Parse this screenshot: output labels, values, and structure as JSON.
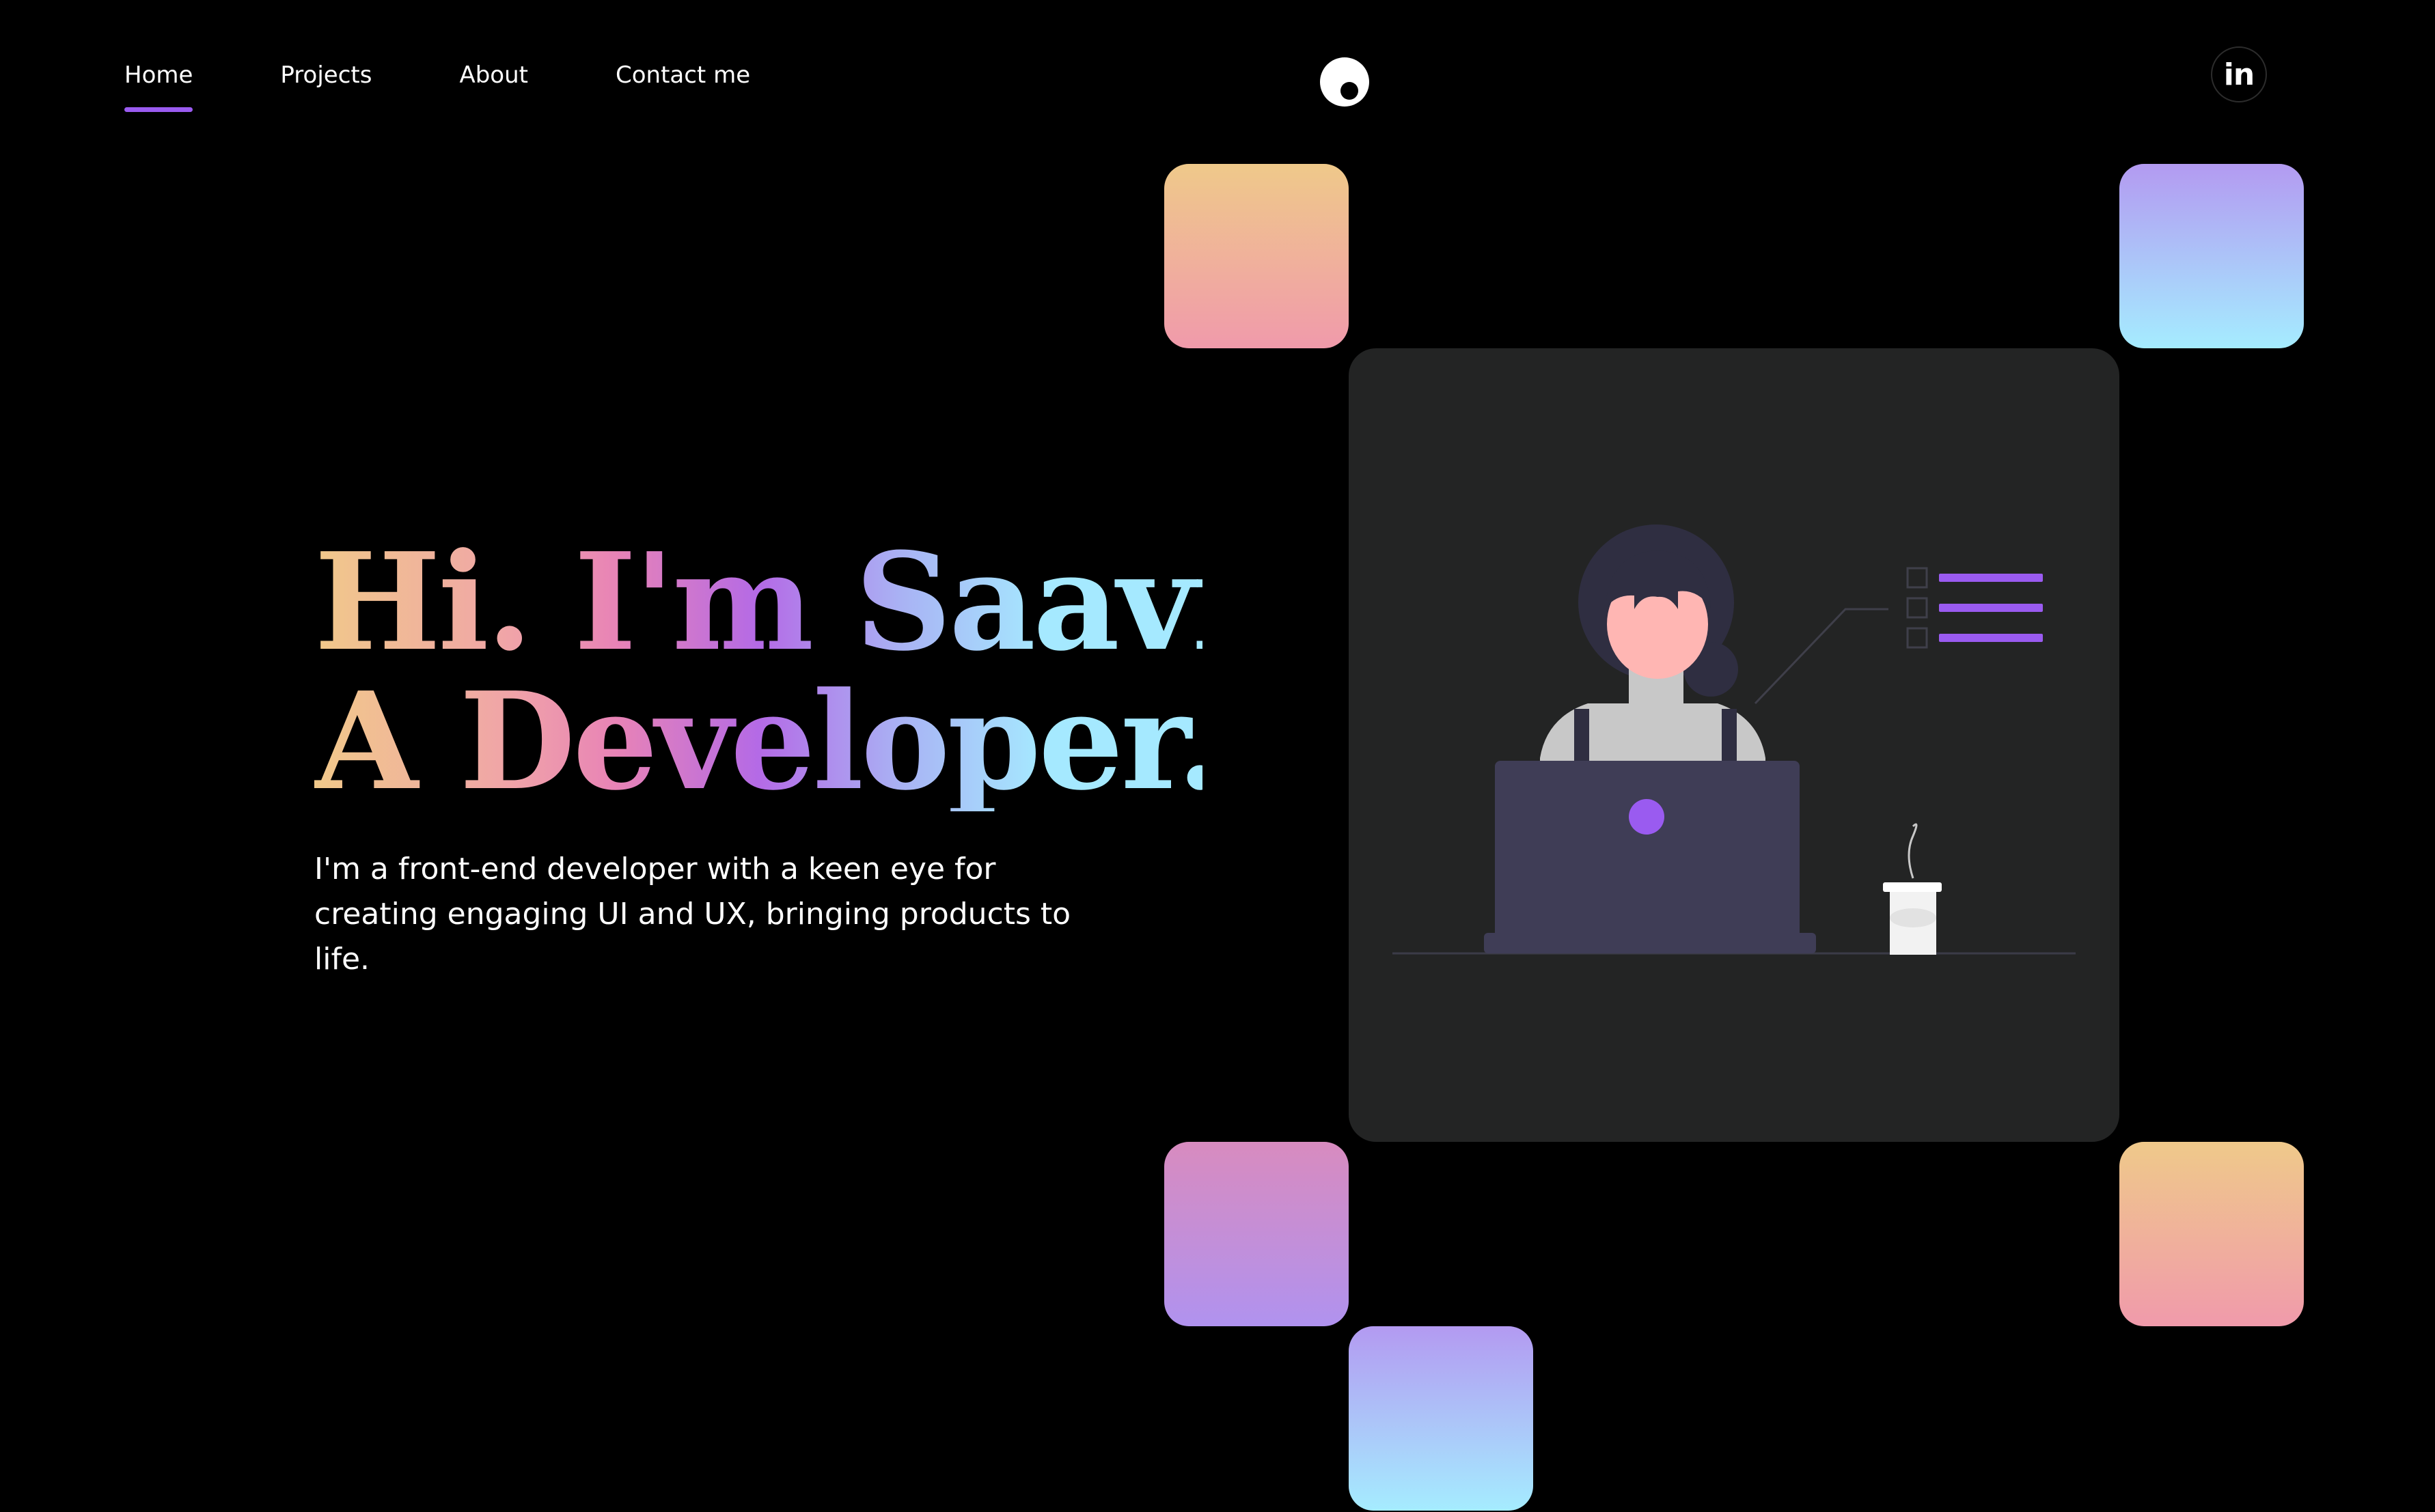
{
  "nav": {
    "items": [
      {
        "label": "Home",
        "active": true
      },
      {
        "label": "Projects",
        "active": false
      },
      {
        "label": "About",
        "active": false
      },
      {
        "label": "Contact me",
        "active": false
      }
    ]
  },
  "social": {
    "linkedin_label": "in"
  },
  "hero": {
    "line1": "Hi. I'm Saavi",
    "line2": "A Developer.",
    "description": "I'm a front-end developer with a keen eye for creating engaging UI and UX, bringing products to life."
  },
  "colors": {
    "background": "#000000",
    "accent": "#9a5bf0",
    "card": "#232424",
    "gradient_peach": "#efc98a",
    "gradient_pink": "#f09aab",
    "gradient_violet": "#b39af1",
    "gradient_cyan": "#a5ecff"
  },
  "icons": {
    "logo": "eye-logo-icon",
    "social": "linkedin-icon"
  }
}
